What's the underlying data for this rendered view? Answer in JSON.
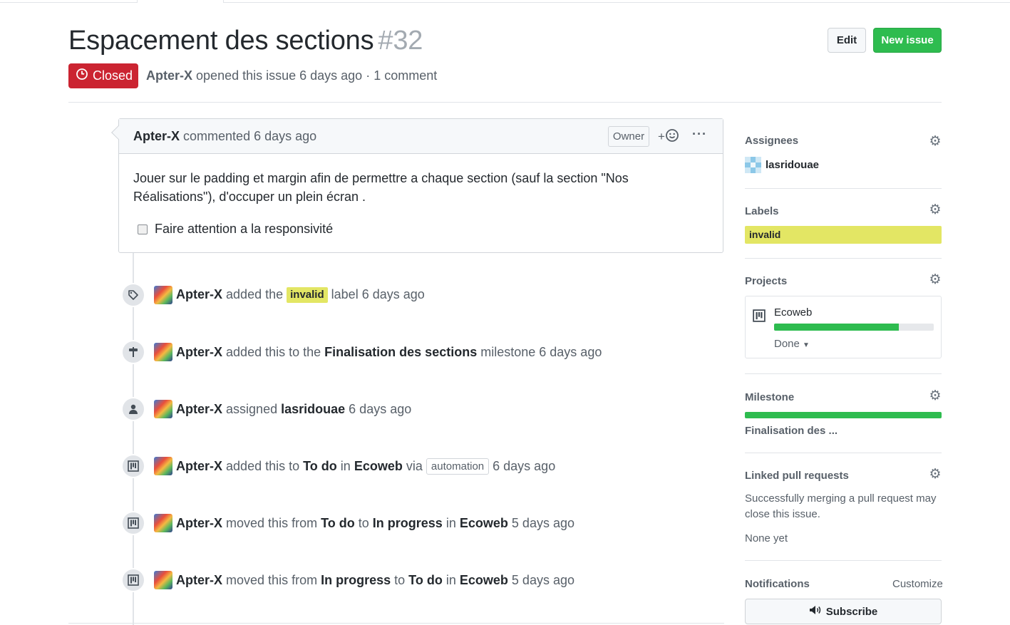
{
  "issue": {
    "title": "Espacement des sections",
    "number": "#32",
    "state": "Closed",
    "author": "Apter-X",
    "meta_text": "opened this issue 6 days ago · 1 comment",
    "edit_label": "Edit",
    "new_issue_label": "New issue"
  },
  "comment": {
    "author": "Apter-X",
    "action": "commented 6 days ago",
    "owner_badge": "Owner",
    "react_label": "+",
    "more_label": "···",
    "body": "Jouer sur le padding et margin afin de permettre a chaque section (sauf la section \"Nos Réalisations\"), d'occuper un plein écran .",
    "task": "Faire attention a la responsivité"
  },
  "timeline": [
    {
      "icon": "tag-icon",
      "actor": "Apter-X",
      "p1": "added the",
      "label": "invalid",
      "p2": "label 6 days ago"
    },
    {
      "icon": "milestone-icon",
      "actor": "Apter-X",
      "p1": "added this to the",
      "b1": "Finalisation des sections",
      "p2": "milestone 6 days ago"
    },
    {
      "icon": "person-icon",
      "actor": "Apter-X",
      "p1": "assigned",
      "b1": "lasridouae",
      "p2": "6 days ago"
    },
    {
      "icon": "project-icon",
      "actor": "Apter-X",
      "p1": "added this to",
      "b1": "To do",
      "p2": "in",
      "b2": "Ecoweb",
      "p3": "via",
      "badge": "automation",
      "p4": "6 days ago"
    },
    {
      "icon": "project-icon",
      "actor": "Apter-X",
      "p1": "moved this from",
      "b1": "To do",
      "p2": "to",
      "b2": "In progress",
      "p3": "in",
      "b3": "Ecoweb",
      "p4": "5 days ago"
    },
    {
      "icon": "project-icon",
      "actor": "Apter-X",
      "p1": "moved this from",
      "b1": "In progress",
      "p2": "to",
      "b2": "To do",
      "p3": "in",
      "b3": "Ecoweb",
      "p4": "5 days ago"
    }
  ],
  "sidebar": {
    "assignees": {
      "heading": "Assignees",
      "user": "lasridouae"
    },
    "labels": {
      "heading": "Labels",
      "label": "invalid",
      "label_color": "#e3e664"
    },
    "projects": {
      "heading": "Projects",
      "name": "Ecoweb",
      "progress": 0.78,
      "column": "Done"
    },
    "milestone": {
      "heading": "Milestone",
      "name": "Finalisation des ...",
      "progress": 1.0
    },
    "linked_prs": {
      "heading": "Linked pull requests",
      "description": "Successfully merging a pull request may close this issue.",
      "none": "None yet"
    },
    "notifications": {
      "heading": "Notifications",
      "customize": "Customize",
      "subscribe": "Subscribe"
    }
  },
  "colors": {
    "closed_red": "#cb2431",
    "green": "#2ebc4f",
    "label_yellow": "#e3e664"
  }
}
